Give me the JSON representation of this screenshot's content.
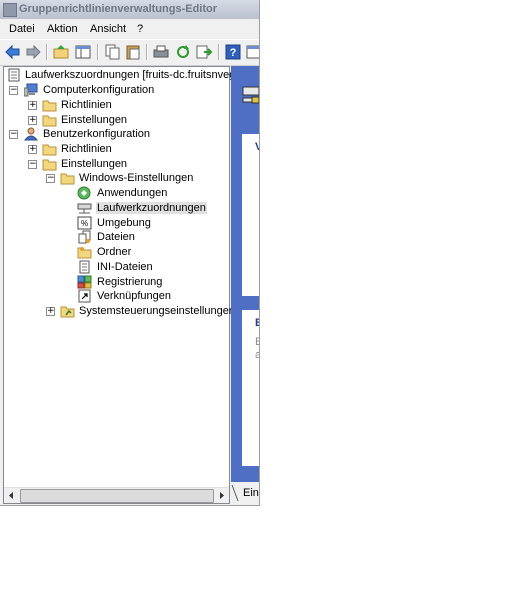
{
  "window": {
    "title": "Gruppenrichtlinienverwaltungs-Editor"
  },
  "menu": {
    "items": [
      "Datei",
      "Aktion",
      "Ansicht",
      "?"
    ]
  },
  "toolbar": {
    "buttons": [
      "back-icon",
      "forward-icon",
      "up-folder-icon",
      "show-hide-tree-icon",
      "copy-icon",
      "paste-icon",
      "print-icon",
      "refresh-icon",
      "export-icon",
      "help-icon",
      "properties-icon"
    ]
  },
  "tree": {
    "root": "Laufwerkszuordnungen [fruits-dc.fruitsnvege",
    "computer": "Computerkonfiguration",
    "computer_richtlinien": "Richtlinien",
    "computer_einstellungen": "Einstellungen",
    "user": "Benutzerkonfiguration",
    "user_richtlinien": "Richtlinien",
    "user_einstellungen": "Einstellungen",
    "windows_einstellungen": "Windows-Einstellungen",
    "anwendungen": "Anwendungen",
    "laufwerkzuordnungen": "Laufwerkzuordnungen",
    "umgebung": "Umgebung",
    "dateien": "Dateien",
    "ordner": "Ordner",
    "ini_dateien": "INI-Dateien",
    "registrierung": "Registrierung",
    "verknuepfungen": "Verknüpfungen",
    "systemsteuerung": "Systemsteuerungseinstellungen"
  },
  "expanders": {
    "plus": "+",
    "minus": "−"
  },
  "rightpane": {
    "card1_letter": "V",
    "card2_letter": "B",
    "card2_line1": "E",
    "card2_line2": "a",
    "tab_label": "Eins"
  },
  "colors": {
    "content_bg": "#4e6fc4",
    "selection": "#e0e0e0",
    "titlebar_text": "#6d7686"
  }
}
